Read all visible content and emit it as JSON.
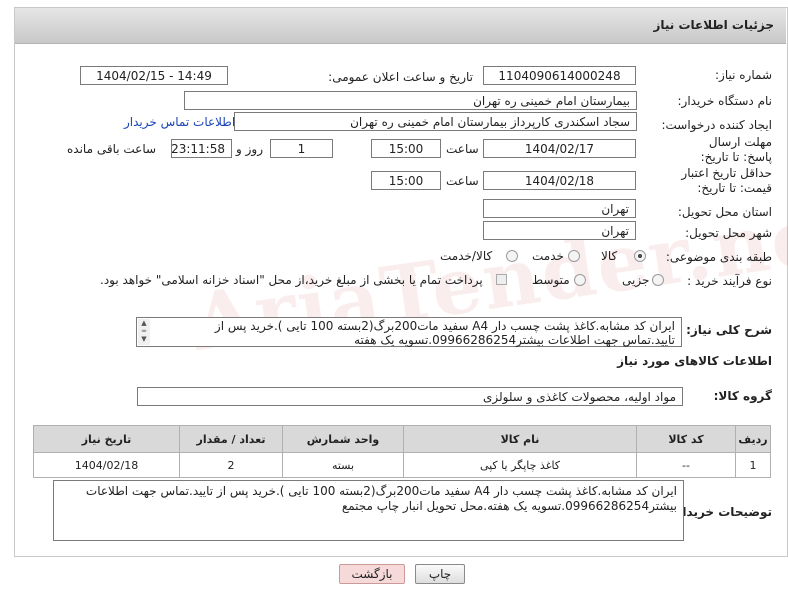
{
  "header": {
    "title": "جزئیات اطلاعات نیاز"
  },
  "labels": {
    "need_number": "شماره نیاز:",
    "announce_datetime": "تاریخ و ساعت اعلان عمومی:",
    "buyer_org": "نام دستگاه خریدار:",
    "requester": "ایجاد کننده درخواست:",
    "reply_deadline": "مهلت ارسال پاسخ: تا تاریخ:",
    "price_validity": "حداقل تاریخ اعتبار قیمت: تا تاریخ:",
    "delivery_province": "استان محل تحویل:",
    "delivery_city": "شهر محل تحویل:",
    "subject_class": "طبقه بندی موضوعی:",
    "purchase_type": "نوع فرآیند خرید :",
    "time": "ساعت",
    "day_and": "روز و",
    "remaining": "ساعت باقی مانده",
    "description": "شرح کلی نیاز:",
    "goods_info": "اطلاعات کالاهای مورد نیاز",
    "goods_group": "گروه کالا:",
    "buyer_notes": "توضیحات خریدار:"
  },
  "fields": {
    "need_number": "1104090614000248",
    "announce_datetime": "1404/02/15 - 14:49",
    "buyer_org": "بیمارستان امام خمینی ره  تهران",
    "requester": "سجاد اسکندری کارپرداز بیمارستان امام خمینی ره  تهران",
    "contact_link": "اطلاعات تماس خریدار",
    "reply_date": "1404/02/17",
    "reply_time": "15:00",
    "reply_days": "1",
    "reply_remaining": "23:11:58",
    "validity_date": "1404/02/18",
    "validity_time": "15:00",
    "province": "تهران",
    "city": "تهران",
    "description": "ایران کد مشابه.کاغذ پشت چسب دار A4 سفید مات200برگ(2بسته 100 تایی ).خرید پس از تایید.تماس جهت اطلاعات بیشتر09966286254.تسویه یک هفته",
    "goods_group": "مواد اولیه، محصولات کاغذی و سلولزی",
    "buyer_notes": "ایران کد مشابه.کاغذ پشت چسب دار A4 سفید مات200برگ(2بسته 100 تایی ).خرید پس از تایید.تماس جهت اطلاعات بیشتر09966286254.تسویه یک هفته.محل تحویل انبار چاپ مجتمع"
  },
  "subject_options": [
    {
      "label": "کالا",
      "selected": true
    },
    {
      "label": "خدمت",
      "selected": false
    },
    {
      "label": "کالا/خدمت",
      "selected": false
    }
  ],
  "purchase_options": [
    {
      "label": "جزیی",
      "selected": false
    },
    {
      "label": "متوسط",
      "selected": false
    }
  ],
  "payment_note": "پرداخت تمام یا بخشی از مبلغ خرید،از محل \"اسناد خزانه اسلامی\" خواهد بود.",
  "table": {
    "headers": [
      "ردیف",
      "کد کالا",
      "نام کالا",
      "واحد شمارش",
      "تعداد / مقدار",
      "تاریخ نیاز"
    ],
    "rows": [
      [
        "1",
        "--",
        "کاغذ چاپگر یا کپی",
        "بسته",
        "2",
        "1404/02/18"
      ]
    ]
  },
  "buttons": {
    "print": "چاپ",
    "back": "بازگشت"
  },
  "watermark": "AriaTender.neT"
}
